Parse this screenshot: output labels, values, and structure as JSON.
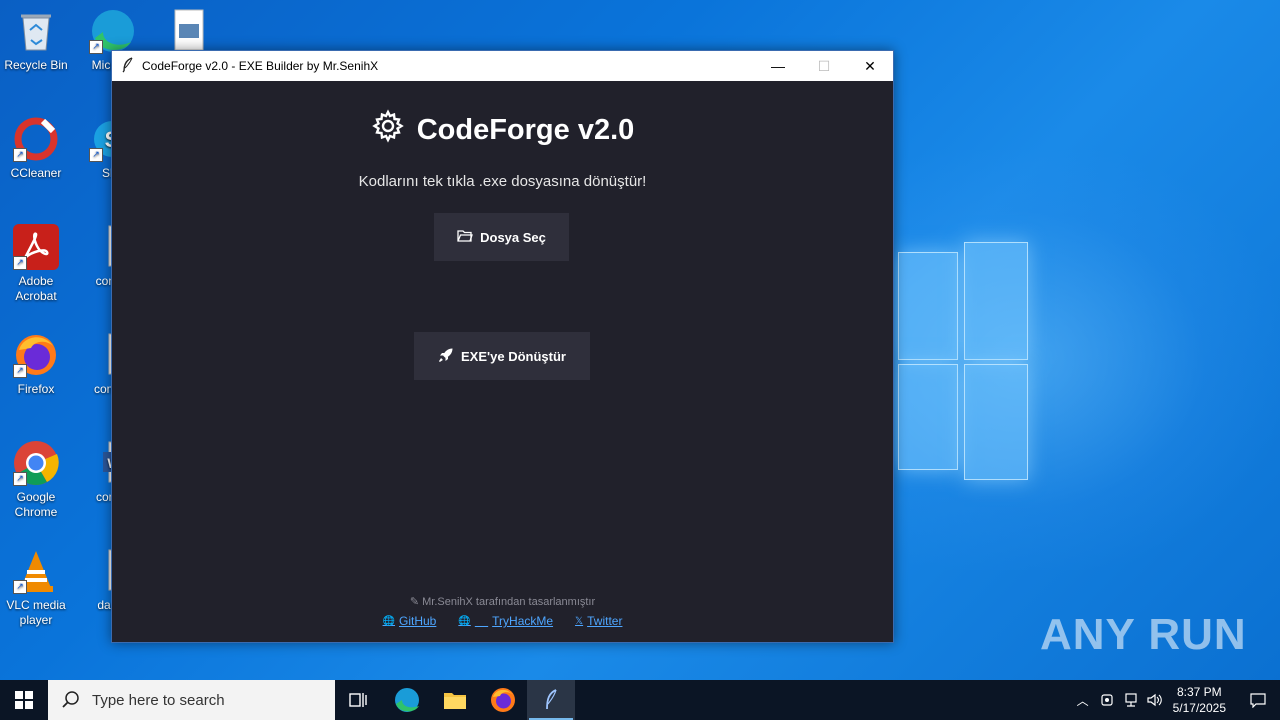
{
  "desktop": {
    "icons": [
      {
        "label": "Recycle Bin"
      },
      {
        "label": "Micr Ed"
      },
      {
        "label": ""
      },
      {
        "label": "CCleaner"
      },
      {
        "label": "Sky"
      },
      {
        "label": "Adobe Acrobat"
      },
      {
        "label": "comm"
      },
      {
        "label": "Firefox"
      },
      {
        "label": "compu"
      },
      {
        "label": "Google Chrome"
      },
      {
        "label": "contai"
      },
      {
        "label": "VLC media player"
      },
      {
        "label": "darkk"
      }
    ],
    "watermark": "ANY RUN"
  },
  "window": {
    "title": "CodeForge v2.0 - EXE Builder by Mr.SenihX",
    "controls": {
      "minimize": "—",
      "maximize": "☐",
      "close": "✕"
    },
    "app_title": "CodeForge v2.0",
    "subtitle": "Kodlarını tek tıkla .exe dosyasına dönüştür!",
    "select_file_button": "Dosya Seç",
    "convert_button": "EXE'ye Dönüştür",
    "credit": "Mr.SenihX tarafından tasarlanmıştır",
    "links": [
      {
        "label": "GitHub",
        "icon": "globe-icon"
      },
      {
        "label": "TryHackMe",
        "icon": "globe-icon"
      },
      {
        "label": "Twitter",
        "icon": "x-icon"
      }
    ]
  },
  "taskbar": {
    "search_placeholder": "Type here to search",
    "time": "8:37 PM",
    "date": "5/17/2025"
  }
}
